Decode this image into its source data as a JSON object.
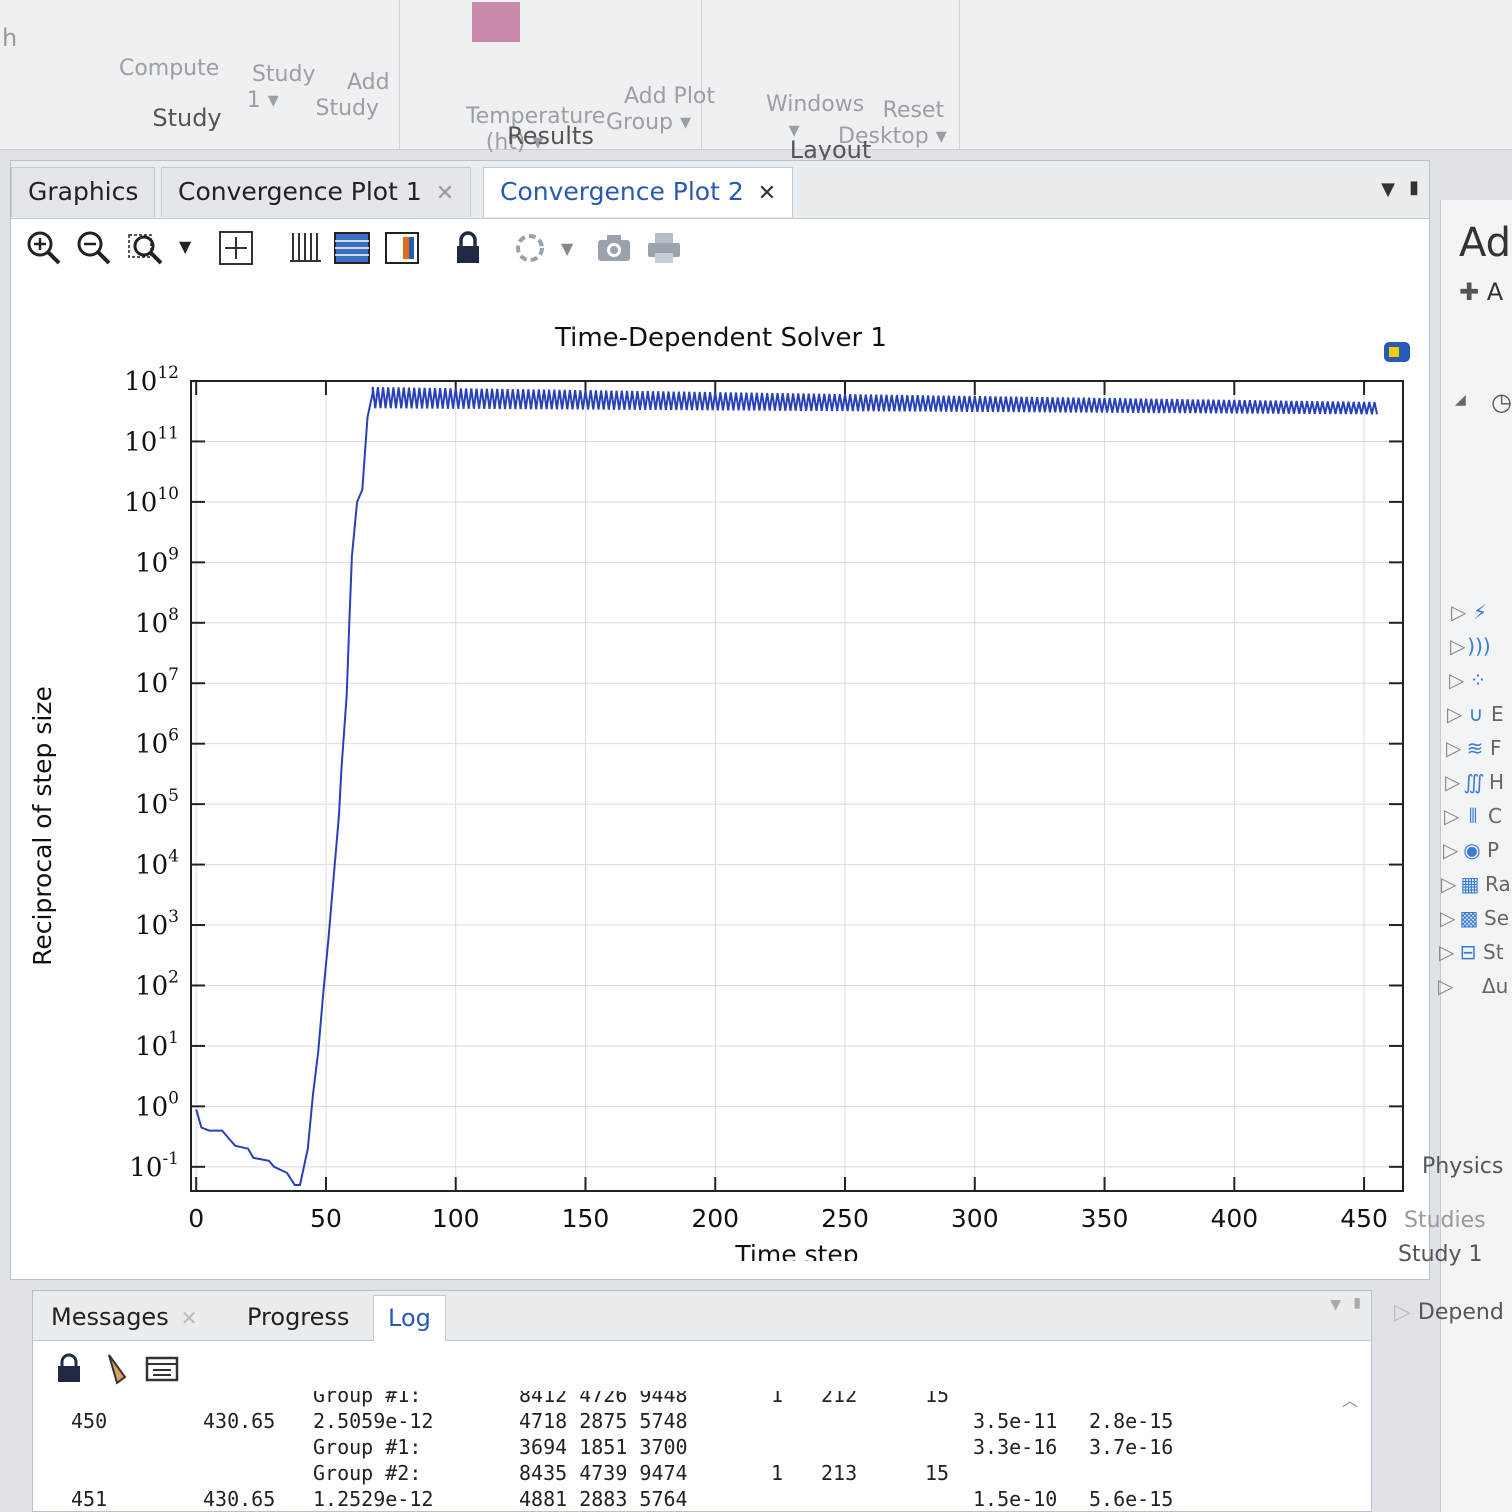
{
  "ribbon": {
    "partial_left": "h",
    "groups": [
      {
        "label": "Study",
        "buttons": [
          {
            "label": "Compute"
          },
          {
            "label": "Study\n1 ▾"
          },
          {
            "label": "Add\nStudy"
          }
        ]
      },
      {
        "label": "Results",
        "buttons": [
          {
            "label": "Temperature\n(ht) ▾"
          },
          {
            "label": "Add Plot\nGroup ▾"
          }
        ]
      },
      {
        "label": "Layout",
        "buttons": [
          {
            "label": "Windows\n▾"
          },
          {
            "label": "Reset\nDesktop ▾"
          }
        ]
      }
    ]
  },
  "tabs": [
    {
      "label": "Graphics",
      "closable": false,
      "active": false
    },
    {
      "label": "Convergence Plot 1",
      "closable": true,
      "active": false
    },
    {
      "label": "Convergence Plot 2",
      "closable": true,
      "active": true
    }
  ],
  "toolbar": {
    "icons": [
      "zoom-in-icon",
      "zoom-out-icon",
      "zoom-box-icon",
      "dropdown-icon",
      "zoom-extents-icon",
      "grid-icon",
      "table-icon",
      "legend-icon",
      "lock-icon",
      "refresh-icon",
      "dropdown-icon",
      "camera-icon",
      "print-icon"
    ]
  },
  "chart_data": {
    "type": "line",
    "title": "Time-Dependent Solver 1",
    "xlabel": "Time step",
    "ylabel": "Reciprocal of step size",
    "yscale": "log",
    "xlim": [
      -2,
      465
    ],
    "ylim_exponent": [
      -1.4,
      12
    ],
    "x_ticks": [
      0,
      50,
      100,
      150,
      200,
      250,
      300,
      350,
      400,
      450
    ],
    "y_ticks": [
      "10^12",
      "10^11",
      "10^10",
      "10^9",
      "10^8",
      "10^7",
      "10^6",
      "10^5",
      "10^4",
      "10^3",
      "10^2",
      "10^1",
      "10^0",
      "10^-1"
    ],
    "grid": true,
    "line_color": "#2840b8",
    "series": [
      {
        "x": [
          0,
          2,
          5,
          10,
          15,
          20,
          22,
          28,
          30,
          35,
          38,
          40,
          43,
          45,
          47,
          49,
          51,
          53,
          55,
          56,
          58,
          59,
          60,
          62,
          64,
          66,
          68
        ],
        "log10y": [
          -0.05,
          -0.35,
          -0.4,
          -0.4,
          -0.65,
          -0.7,
          -0.85,
          -0.9,
          -1.0,
          -1.1,
          -1.3,
          -1.3,
          -0.7,
          0.2,
          0.9,
          1.9,
          2.8,
          3.8,
          4.8,
          5.6,
          6.8,
          8.0,
          9.1,
          10.0,
          10.2,
          11.4,
          11.8
        ]
      }
    ],
    "oscillation_band_log10": [
      11.55,
      11.9
    ],
    "oscillation_range_x": [
      68,
      455
    ]
  },
  "side_panel": {
    "title": "Add",
    "add_label": "A",
    "items": [
      {
        "icon": "electric-icon",
        "label": ""
      },
      {
        "icon": "acoustics-icon",
        "label": ""
      },
      {
        "icon": "particles-icon",
        "label": ""
      },
      {
        "icon": "magnet-icon",
        "label": "E"
      },
      {
        "icon": "flow-icon",
        "label": "F"
      },
      {
        "icon": "heat-icon",
        "label": "H"
      },
      {
        "icon": "optics-icon",
        "label": "C"
      },
      {
        "icon": "plasma-icon",
        "label": "P"
      },
      {
        "icon": "radio-icon",
        "label": "Ra"
      },
      {
        "icon": "semiconductor-icon",
        "label": "Se"
      },
      {
        "icon": "structure-icon",
        "label": "St"
      },
      {
        "icon": "math-icon",
        "label": "Δu M"
      }
    ],
    "footer": {
      "physics": "Physics in",
      "studies": "Studies",
      "study1": "Study 1",
      "depend": "Depend"
    }
  },
  "log_panel": {
    "tabs": [
      {
        "label": "Messages",
        "closable": true,
        "active": false
      },
      {
        "label": "Progress",
        "closable": false,
        "active": false
      },
      {
        "label": "Log",
        "closable": false,
        "active": true
      }
    ],
    "rows": [
      {
        "c1": "",
        "c2": "",
        "c3": "Group #1:",
        "c4": "8412 4726 9448",
        "c5": "1",
        "c6": "212",
        "c7": "15",
        "c8": "",
        "c9": ""
      },
      {
        "c1": "450",
        "c2": "430.65",
        "c3": "2.5059e-12",
        "c4": "4718 2875 5748",
        "c5": "",
        "c6": "",
        "c7": "",
        "c8": "3.5e-11",
        "c9": "2.8e-15"
      },
      {
        "c1": "",
        "c2": "",
        "c3": "Group #1:",
        "c4": "3694 1851 3700",
        "c5": "",
        "c6": "",
        "c7": "",
        "c8": "3.3e-16",
        "c9": "3.7e-16"
      },
      {
        "c1": "",
        "c2": "",
        "c3": "Group #2:",
        "c4": "8435 4739 9474",
        "c5": "1",
        "c6": "213",
        "c7": "15",
        "c8": "",
        "c9": ""
      },
      {
        "c1": "451",
        "c2": "430.65",
        "c3": "1.2529e-12",
        "c4": "4881 2883 5764",
        "c5": "",
        "c6": "",
        "c7": "",
        "c8": "1.5e-10",
        "c9": "5.6e-15"
      }
    ]
  }
}
